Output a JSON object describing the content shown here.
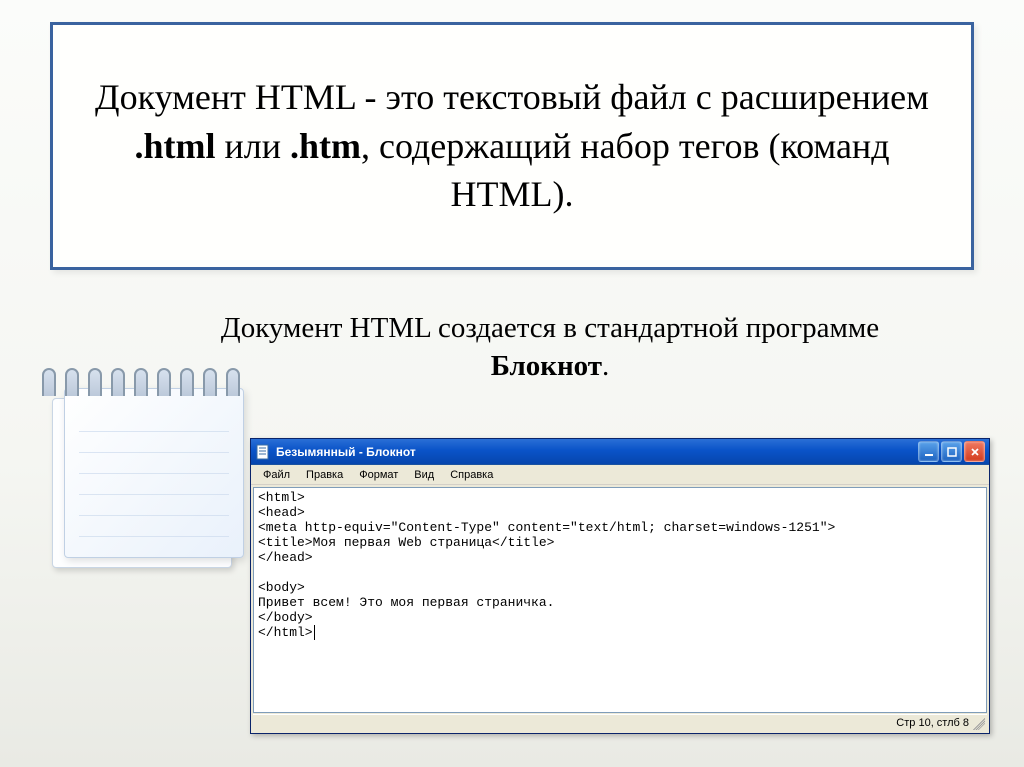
{
  "framebox": {
    "text_parts": {
      "p1": "Документ HTML - это текстовый файл с расширением ",
      "b1": ".html",
      "p2": " или ",
      "b2": ".htm",
      "p3": ", содержащий набор тегов (команд HTML)."
    }
  },
  "subtitle": {
    "p1": "Документ HTML создается в стандартной программе ",
    "b1": "Блокнот",
    "p2": "."
  },
  "notepad_window": {
    "title": "Безымянный - Блокнот",
    "menu": {
      "file": "Файл",
      "edit": "Правка",
      "format": "Формат",
      "view": "Вид",
      "help": "Справка"
    },
    "code_lines": {
      "l1": "<html>",
      "l2": "<head>",
      "l3": "<meta http-equiv=\"Content-Type\" content=\"text/html; charset=windows-1251\">",
      "l4": "<title>Моя первая Web страница</title>",
      "l5": "</head>",
      "l6": "",
      "l7": "<body>",
      "l8": "Привет всем! Это моя первая страничка.",
      "l9": "</body>",
      "l10": "</html>"
    },
    "status": "Стр 10, стлб 8"
  }
}
